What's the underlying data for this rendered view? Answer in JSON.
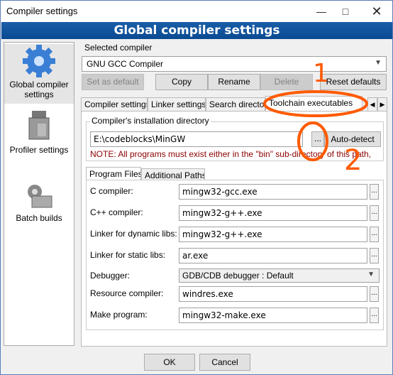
{
  "window": {
    "title": "Compiler settings"
  },
  "banner": {
    "title": "Global compiler settings"
  },
  "sidebar": {
    "items": [
      {
        "label_line1": "Global compiler",
        "label_line2": "settings"
      },
      {
        "label": "Profiler settings"
      },
      {
        "label": "Batch builds"
      }
    ]
  },
  "selected_compiler": {
    "label": "Selected compiler",
    "value": "GNU GCC Compiler"
  },
  "buttons": {
    "set_default": "Set as default",
    "copy": "Copy",
    "rename": "Rename",
    "delete": "Delete",
    "reset_defaults": "Reset defaults"
  },
  "tabs": [
    "Compiler settings",
    "Linker settings",
    "Search directories",
    "Toolchain executables"
  ],
  "toolchain": {
    "install_dir_label": "Compiler's installation directory",
    "install_dir_value": "E:\\codeblocks\\MinGW",
    "browse": "...",
    "auto_detect": "Auto-detect",
    "note": "NOTE: All programs must exist either in the \"bin\" sub-directory of this path,",
    "subtabs": [
      "Program Files",
      "Additional Paths"
    ],
    "fields": [
      {
        "label": "C compiler:",
        "value": "mingw32-gcc.exe"
      },
      {
        "label": "C++ compiler:",
        "value": "mingw32-g++.exe"
      },
      {
        "label": "Linker for dynamic libs:",
        "value": "mingw32-g++.exe"
      },
      {
        "label": "Linker for static libs:",
        "value": "ar.exe"
      },
      {
        "label": "Debugger:",
        "value": "GDB/CDB debugger : Default"
      },
      {
        "label": "Resource compiler:",
        "value": "windres.exe"
      },
      {
        "label": "Make program:",
        "value": "mingw32-make.exe"
      }
    ]
  },
  "footer": {
    "ok": "OK",
    "cancel": "Cancel"
  },
  "annotations": {
    "mark1": "1",
    "mark2": "2"
  },
  "colors": {
    "banner": "#1a5ea8",
    "annotation": "#ff5a00",
    "note": "#8b0000"
  }
}
